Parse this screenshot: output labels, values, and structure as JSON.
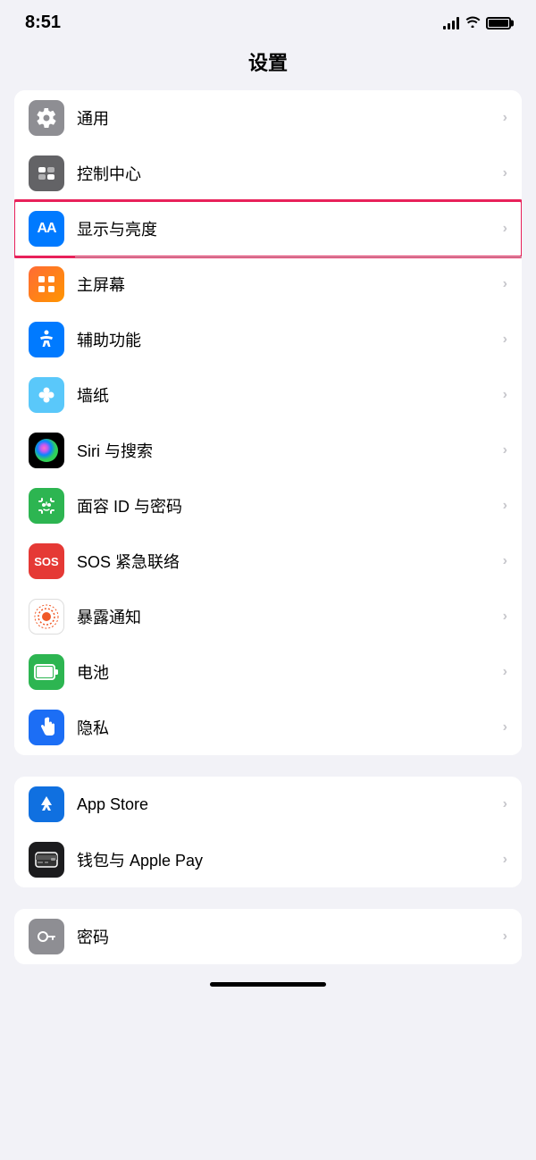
{
  "statusBar": {
    "time": "8:51",
    "signal": "signal",
    "wifi": "wifi",
    "battery": "battery"
  },
  "pageTitle": "设置",
  "groups": [
    {
      "id": "group1",
      "items": [
        {
          "id": "tongyong",
          "label": "通用",
          "iconBg": "icon-gray",
          "iconType": "gear",
          "highlighted": false
        },
        {
          "id": "kongzhizhongxin",
          "label": "控制中心",
          "iconBg": "icon-gray2",
          "iconType": "toggle",
          "highlighted": false
        },
        {
          "id": "xianshi",
          "label": "显示与亮度",
          "iconBg": "icon-blue",
          "iconType": "aa",
          "highlighted": true
        },
        {
          "id": "zhupingmu",
          "label": "主屏幕",
          "iconBg": "icon-grid",
          "iconType": "grid",
          "highlighted": false
        },
        {
          "id": "fuzhugongneng",
          "label": "辅助功能",
          "iconBg": "icon-access",
          "iconType": "accessibility",
          "highlighted": false
        },
        {
          "id": "qiangzhi",
          "label": "墙纸",
          "iconBg": "icon-wallpaper",
          "iconType": "flower",
          "highlighted": false
        },
        {
          "id": "siri",
          "label": "Siri 与搜索",
          "iconBg": "icon-siri",
          "iconType": "siri",
          "highlighted": false
        },
        {
          "id": "mianrong",
          "label": "面容 ID 与密码",
          "iconBg": "icon-face",
          "iconType": "face",
          "highlighted": false
        },
        {
          "id": "sos",
          "label": "SOS 紧急联络",
          "iconBg": "icon-sos",
          "iconType": "sos",
          "highlighted": false
        },
        {
          "id": "baolu",
          "label": "暴露通知",
          "iconBg": "icon-exposure",
          "iconType": "exposure",
          "highlighted": false
        },
        {
          "id": "dianci",
          "label": "电池",
          "iconBg": "icon-battery",
          "iconType": "battery",
          "highlighted": false
        },
        {
          "id": "yinsi",
          "label": "隐私",
          "iconBg": "icon-privacy",
          "iconType": "hand",
          "highlighted": false
        }
      ]
    },
    {
      "id": "group2",
      "items": [
        {
          "id": "appstore",
          "label": "App Store",
          "iconBg": "icon-appstore",
          "iconType": "appstore",
          "highlighted": false
        },
        {
          "id": "wallet",
          "label": "钱包与 Apple Pay",
          "iconBg": "icon-wallet",
          "iconType": "wallet",
          "highlighted": false
        }
      ]
    },
    {
      "id": "group3",
      "items": [
        {
          "id": "mima",
          "label": "密码",
          "iconBg": "icon-password",
          "iconType": "key",
          "highlighted": false,
          "partial": true
        }
      ]
    }
  ],
  "chevron": "›"
}
